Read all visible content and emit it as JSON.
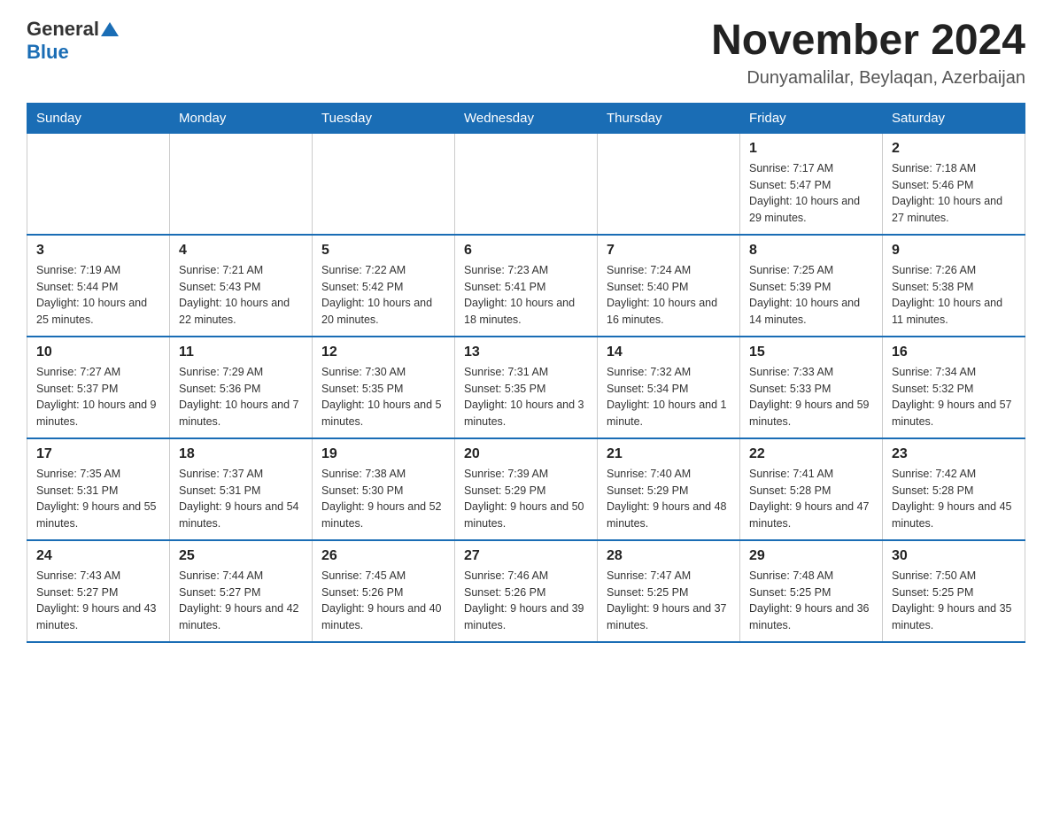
{
  "header": {
    "title": "November 2024",
    "location": "Dunyamalilar, Beylaqan, Azerbaijan"
  },
  "logo": {
    "general": "General",
    "blue": "Blue"
  },
  "days_of_week": [
    "Sunday",
    "Monday",
    "Tuesday",
    "Wednesday",
    "Thursday",
    "Friday",
    "Saturday"
  ],
  "weeks": [
    {
      "days": [
        {
          "number": "",
          "info": ""
        },
        {
          "number": "",
          "info": ""
        },
        {
          "number": "",
          "info": ""
        },
        {
          "number": "",
          "info": ""
        },
        {
          "number": "",
          "info": ""
        },
        {
          "number": "1",
          "info": "Sunrise: 7:17 AM\nSunset: 5:47 PM\nDaylight: 10 hours and 29 minutes."
        },
        {
          "number": "2",
          "info": "Sunrise: 7:18 AM\nSunset: 5:46 PM\nDaylight: 10 hours and 27 minutes."
        }
      ]
    },
    {
      "days": [
        {
          "number": "3",
          "info": "Sunrise: 7:19 AM\nSunset: 5:44 PM\nDaylight: 10 hours and 25 minutes."
        },
        {
          "number": "4",
          "info": "Sunrise: 7:21 AM\nSunset: 5:43 PM\nDaylight: 10 hours and 22 minutes."
        },
        {
          "number": "5",
          "info": "Sunrise: 7:22 AM\nSunset: 5:42 PM\nDaylight: 10 hours and 20 minutes."
        },
        {
          "number": "6",
          "info": "Sunrise: 7:23 AM\nSunset: 5:41 PM\nDaylight: 10 hours and 18 minutes."
        },
        {
          "number": "7",
          "info": "Sunrise: 7:24 AM\nSunset: 5:40 PM\nDaylight: 10 hours and 16 minutes."
        },
        {
          "number": "8",
          "info": "Sunrise: 7:25 AM\nSunset: 5:39 PM\nDaylight: 10 hours and 14 minutes."
        },
        {
          "number": "9",
          "info": "Sunrise: 7:26 AM\nSunset: 5:38 PM\nDaylight: 10 hours and 11 minutes."
        }
      ]
    },
    {
      "days": [
        {
          "number": "10",
          "info": "Sunrise: 7:27 AM\nSunset: 5:37 PM\nDaylight: 10 hours and 9 minutes."
        },
        {
          "number": "11",
          "info": "Sunrise: 7:29 AM\nSunset: 5:36 PM\nDaylight: 10 hours and 7 minutes."
        },
        {
          "number": "12",
          "info": "Sunrise: 7:30 AM\nSunset: 5:35 PM\nDaylight: 10 hours and 5 minutes."
        },
        {
          "number": "13",
          "info": "Sunrise: 7:31 AM\nSunset: 5:35 PM\nDaylight: 10 hours and 3 minutes."
        },
        {
          "number": "14",
          "info": "Sunrise: 7:32 AM\nSunset: 5:34 PM\nDaylight: 10 hours and 1 minute."
        },
        {
          "number": "15",
          "info": "Sunrise: 7:33 AM\nSunset: 5:33 PM\nDaylight: 9 hours and 59 minutes."
        },
        {
          "number": "16",
          "info": "Sunrise: 7:34 AM\nSunset: 5:32 PM\nDaylight: 9 hours and 57 minutes."
        }
      ]
    },
    {
      "days": [
        {
          "number": "17",
          "info": "Sunrise: 7:35 AM\nSunset: 5:31 PM\nDaylight: 9 hours and 55 minutes."
        },
        {
          "number": "18",
          "info": "Sunrise: 7:37 AM\nSunset: 5:31 PM\nDaylight: 9 hours and 54 minutes."
        },
        {
          "number": "19",
          "info": "Sunrise: 7:38 AM\nSunset: 5:30 PM\nDaylight: 9 hours and 52 minutes."
        },
        {
          "number": "20",
          "info": "Sunrise: 7:39 AM\nSunset: 5:29 PM\nDaylight: 9 hours and 50 minutes."
        },
        {
          "number": "21",
          "info": "Sunrise: 7:40 AM\nSunset: 5:29 PM\nDaylight: 9 hours and 48 minutes."
        },
        {
          "number": "22",
          "info": "Sunrise: 7:41 AM\nSunset: 5:28 PM\nDaylight: 9 hours and 47 minutes."
        },
        {
          "number": "23",
          "info": "Sunrise: 7:42 AM\nSunset: 5:28 PM\nDaylight: 9 hours and 45 minutes."
        }
      ]
    },
    {
      "days": [
        {
          "number": "24",
          "info": "Sunrise: 7:43 AM\nSunset: 5:27 PM\nDaylight: 9 hours and 43 minutes."
        },
        {
          "number": "25",
          "info": "Sunrise: 7:44 AM\nSunset: 5:27 PM\nDaylight: 9 hours and 42 minutes."
        },
        {
          "number": "26",
          "info": "Sunrise: 7:45 AM\nSunset: 5:26 PM\nDaylight: 9 hours and 40 minutes."
        },
        {
          "number": "27",
          "info": "Sunrise: 7:46 AM\nSunset: 5:26 PM\nDaylight: 9 hours and 39 minutes."
        },
        {
          "number": "28",
          "info": "Sunrise: 7:47 AM\nSunset: 5:25 PM\nDaylight: 9 hours and 37 minutes."
        },
        {
          "number": "29",
          "info": "Sunrise: 7:48 AM\nSunset: 5:25 PM\nDaylight: 9 hours and 36 minutes."
        },
        {
          "number": "30",
          "info": "Sunrise: 7:50 AM\nSunset: 5:25 PM\nDaylight: 9 hours and 35 minutes."
        }
      ]
    }
  ]
}
